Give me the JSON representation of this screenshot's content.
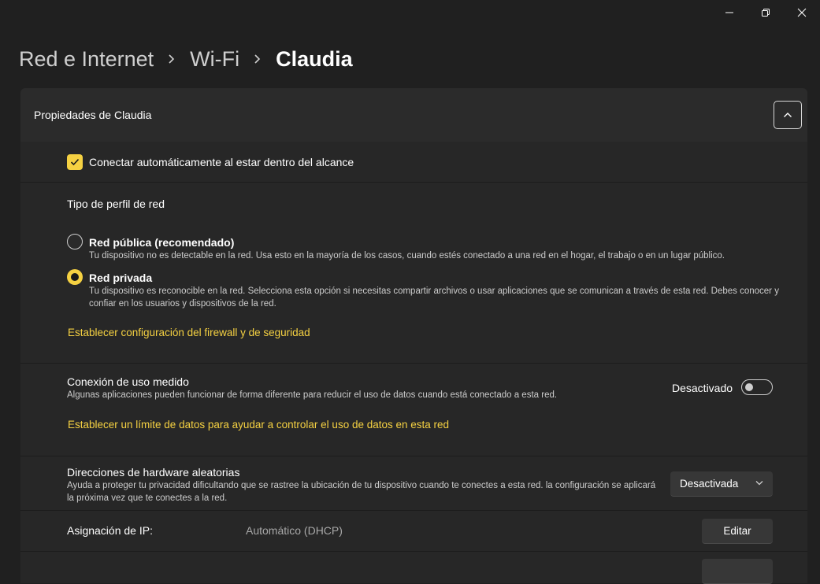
{
  "window": {
    "controls": [
      "minimize-icon",
      "restore-icon",
      "close-icon"
    ]
  },
  "breadcrumb": {
    "items": [
      "Red e Internet",
      "Wi-Fi"
    ],
    "current": "Claudia"
  },
  "panel": {
    "title": "Propiedades de Claudia",
    "auto_connect": {
      "label": "Conectar automáticamente al estar dentro del alcance",
      "checked": true
    },
    "profile": {
      "heading": "Tipo de perfil de red",
      "public": {
        "label": "Red pública (recomendado)",
        "description": "Tu dispositivo no es detectable en la red. Usa esto en la mayoría de los casos, cuando estés conectado a una red en el hogar, el trabajo o en un lugar público.",
        "selected": false
      },
      "private": {
        "label": "Red privada",
        "description": "Tu dispositivo es reconocible en la red. Selecciona esta opción si necesitas compartir archivos o usar aplicaciones que se comunican a través de esta red. Debes conocer y confiar en los usuarios y dispositivos de la red.",
        "selected": true
      },
      "firewall_link": "Establecer configuración del firewall y de seguridad"
    },
    "metered": {
      "title": "Conexión de uso medido",
      "description": "Algunas aplicaciones pueden funcionar de forma diferente para reducir el uso de datos cuando está conectado a esta red.",
      "state_label": "Desactivado",
      "on": false,
      "data_limit_link": "Establecer un límite de datos para ayudar a controlar el uso de datos en esta red"
    },
    "random_hw": {
      "title": "Direcciones de hardware aleatorias",
      "description": "Ayuda a proteger tu privacidad dificultando que se rastree la ubicación de tu dispositivo cuando te conectes a esta red. la configuración se aplicará la próxima vez que te conectes a la red.",
      "value": "Desactivada"
    },
    "ip_assignment": {
      "label": "Asignación de IP:",
      "value": "Automático (DHCP)",
      "button": "Editar"
    }
  },
  "colors": {
    "accent": "#f5d142",
    "background": "#202020",
    "card": "#272727",
    "header": "#2b2b2b"
  }
}
